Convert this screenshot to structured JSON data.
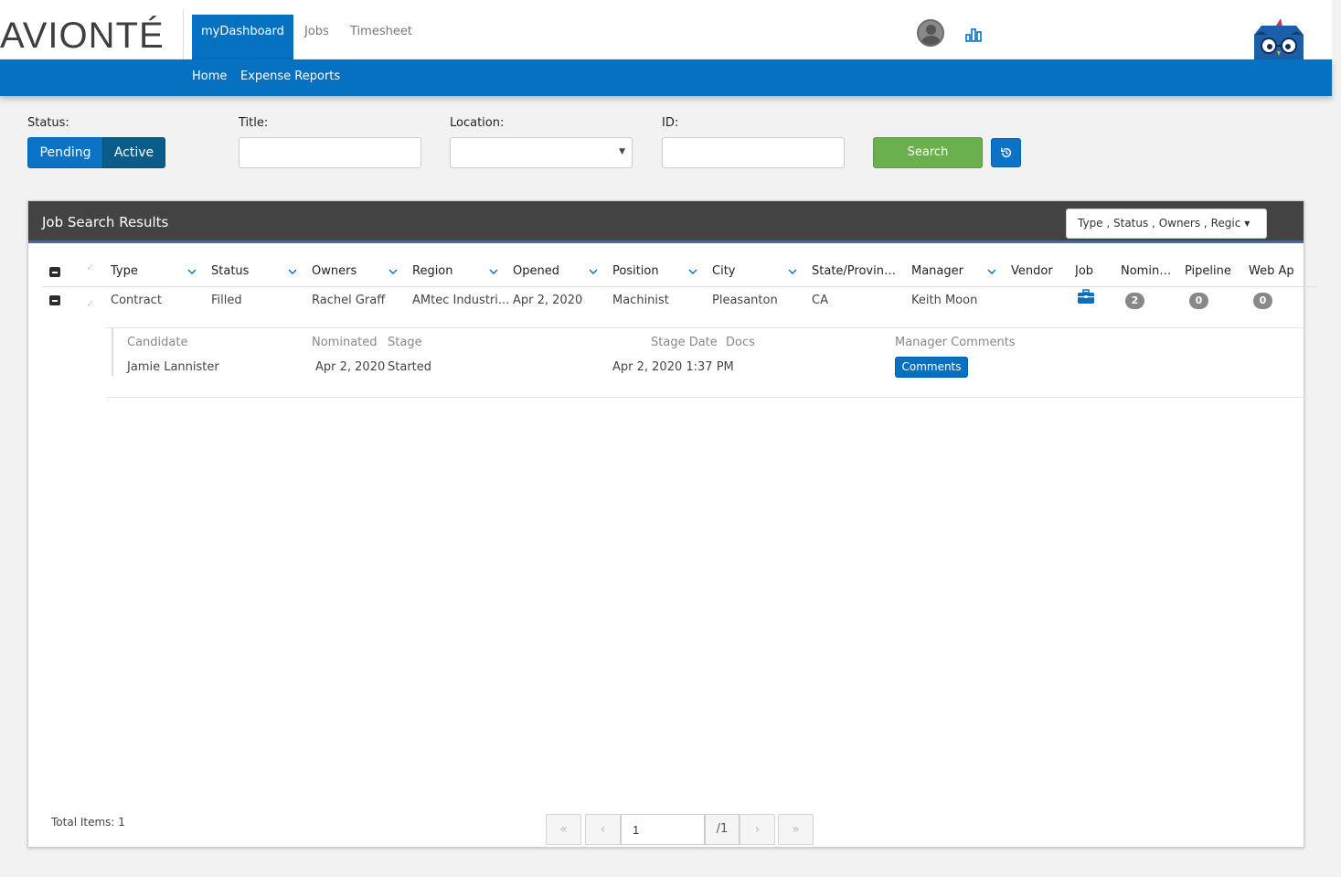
{
  "brand": {
    "logo_text": "AVIONTÉ"
  },
  "nav": {
    "tabs": [
      {
        "label": "myDashboard",
        "active": true
      },
      {
        "label": "Jobs"
      },
      {
        "label": "Timesheet"
      }
    ],
    "sub_links": [
      "Home",
      "Expense Reports"
    ]
  },
  "header_icons": [
    "user-avatar-icon",
    "bar-chart-icon",
    "owl-mascot-icon"
  ],
  "filters": {
    "status_label": "Status:",
    "status_options": [
      "Pending",
      "Active"
    ],
    "status_selected": "Active",
    "title_label": "Title:",
    "title_value": "",
    "location_label": "Location:",
    "location_value": "",
    "id_label": "ID:",
    "id_value": "",
    "search_label": "Search"
  },
  "results": {
    "title": "Job Search Results",
    "column_selector": "Type , Status , Owners , Regic",
    "columns": [
      "Type",
      "Status",
      "Owners",
      "Region",
      "Opened",
      "Position",
      "City",
      "State/Province",
      "Manager",
      "Vendor",
      "Job",
      "Nominated",
      "Pipeline",
      "Web Ap"
    ],
    "rows": [
      {
        "type": "Contract",
        "status": "Filled",
        "owners": "Rachel Graff",
        "region": "AMtec Industri...",
        "opened": "Apr 2, 2020",
        "position": "Machinist",
        "city": "Pleasanton",
        "state": "CA",
        "manager": "Keith Moon",
        "vendor": "",
        "nominated": "2",
        "pipeline": "0",
        "web_ap": "0"
      }
    ],
    "candidates": {
      "columns": [
        "Candidate",
        "Nominated",
        "Stage",
        "Stage Date",
        "Docs",
        "Manager Comments"
      ],
      "rows": [
        {
          "candidate": "Jamie Lannister",
          "nominated": "Apr 2, 2020",
          "stage": "Started",
          "stage_date": "Apr 2, 2020 1:37 PM",
          "docs": "",
          "comments_label": "Comments"
        }
      ]
    },
    "total_items": "Total Items: 1",
    "pager": {
      "current_page": "1",
      "total_pages": "/1"
    }
  },
  "colors": {
    "brand_blue": "#0670c1",
    "search_green": "#6ab04c",
    "panel_header": "#434343"
  }
}
